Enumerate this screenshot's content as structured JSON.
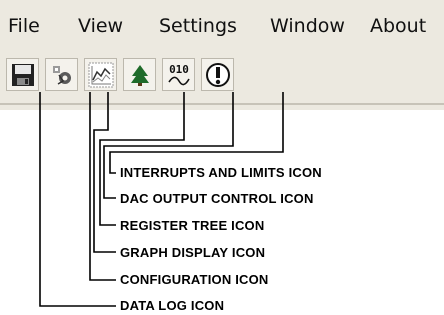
{
  "menu": {
    "items": [
      {
        "label": "File"
      },
      {
        "label": "View"
      },
      {
        "label": "Settings"
      },
      {
        "label": "Window"
      },
      {
        "label": "About"
      }
    ]
  },
  "toolbar": {
    "buttons": [
      {
        "icon": "floppy-disk-icon"
      },
      {
        "icon": "configuration-icon"
      },
      {
        "icon": "graph-display-icon"
      },
      {
        "icon": "register-tree-icon"
      },
      {
        "icon": "dac-output-icon",
        "glyph": "010"
      },
      {
        "icon": "interrupts-limits-icon",
        "glyph": "!"
      }
    ]
  },
  "callouts": [
    {
      "label": "INTERRUPTS AND LIMITS ICON"
    },
    {
      "label": "DAC OUTPUT CONTROL ICON"
    },
    {
      "label": "REGISTER TREE ICON"
    },
    {
      "label": "GRAPH DISPLAY ICON"
    },
    {
      "label": "CONFIGURATION ICON"
    },
    {
      "label": "DATA LOG ICON"
    }
  ],
  "colors": {
    "chrome": "#ece9e0",
    "tree_green": "#1f6b2a",
    "line": "#000000"
  }
}
